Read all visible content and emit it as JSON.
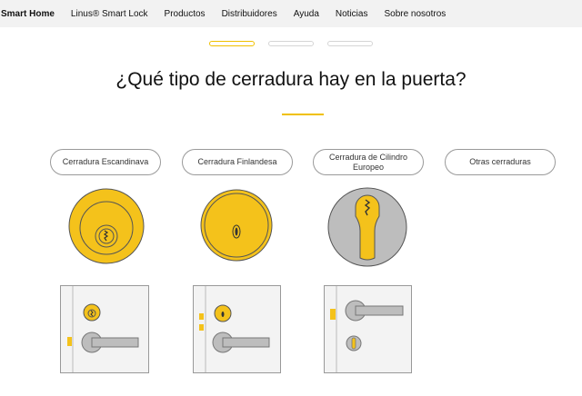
{
  "nav": {
    "brand": "Smart Home",
    "items": [
      "Linus® Smart Lock",
      "Productos",
      "Distribuidores",
      "Ayuda",
      "Noticias",
      "Sobre nosotros"
    ]
  },
  "progress": {
    "total_steps": 3,
    "current_step": 1
  },
  "question": {
    "title": "¿Qué tipo de cerradura hay en la puerta?"
  },
  "options": [
    {
      "label": "Cerradura Escandinava",
      "icon": "scandinavian-lock-icon",
      "door_icon": "scandinavian-door-icon"
    },
    {
      "label": "Cerradura Finlandesa",
      "icon": "finnish-lock-icon",
      "door_icon": "finnish-door-icon"
    },
    {
      "label": "Cerradura de Cilindro Europeo",
      "icon": "euro-cylinder-lock-icon",
      "door_icon": "euro-cylinder-door-icon"
    },
    {
      "label": "Otras cerraduras"
    }
  ],
  "colors": {
    "accent": "#F0C000",
    "lock_gold": "#F4C21B",
    "grey": "#B9B9B9",
    "nav_bg": "#F2F2F2"
  }
}
